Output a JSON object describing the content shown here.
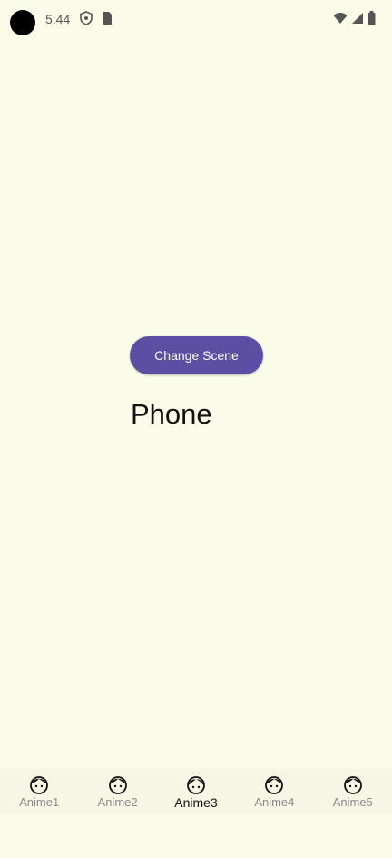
{
  "status_bar": {
    "time": "5:44",
    "left_icons": [
      "shield-icon",
      "sim-card-icon"
    ],
    "right_icons": [
      "wifi-icon",
      "signal-icon",
      "battery-icon"
    ]
  },
  "main": {
    "change_scene_label": "Change Scene",
    "title": "Phone"
  },
  "bottom_nav": {
    "items": [
      {
        "label": "Anime1",
        "icon": "anime-face-icon"
      },
      {
        "label": "Anime2",
        "icon": "anime-face-icon"
      },
      {
        "label": "Anime3",
        "icon": "anime-face-icon"
      },
      {
        "label": "Anime4",
        "icon": "anime-face-icon"
      },
      {
        "label": "Anime5",
        "icon": "anime-face-icon"
      }
    ],
    "selected_label": "Anime3"
  },
  "colors": {
    "background": "#fbfbe9",
    "button": "#5c4ea3",
    "nav_inactive": "#8a8a8a",
    "nav_active": "#111111"
  }
}
